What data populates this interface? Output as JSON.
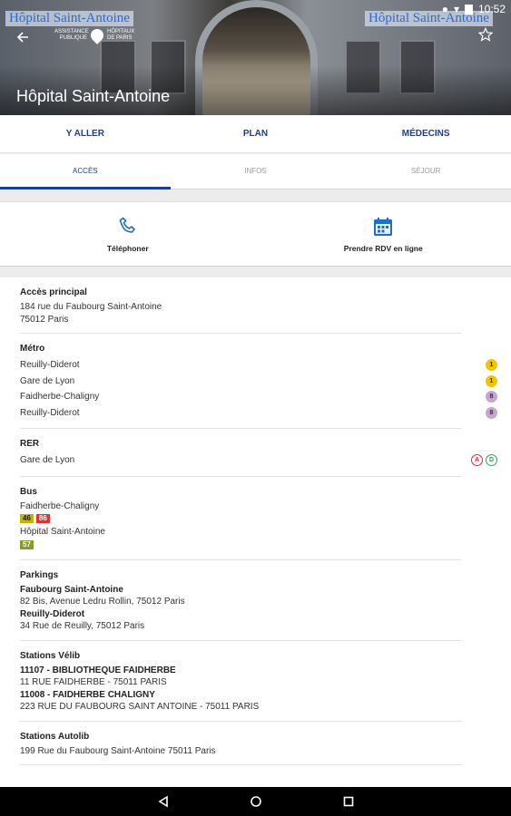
{
  "status_bar": {
    "time": "10:52"
  },
  "hero": {
    "title": "Hôpital Saint-Antoine",
    "sign_left": "Hôpital Saint-Antoine",
    "sign_right": "Hôpital Saint-Antoine",
    "logo_text_left": "ASSISTANCE PUBLIQUE",
    "logo_text_right": "HÔPITAUX DE PARIS"
  },
  "tabs": [
    {
      "label": "Y ALLER"
    },
    {
      "label": "PLAN"
    },
    {
      "label": "MÉDECINS"
    }
  ],
  "subtabs": [
    {
      "label": "ACCÈS",
      "active": true
    },
    {
      "label": "INFOS"
    },
    {
      "label": "SÉJOUR"
    }
  ],
  "actions": [
    {
      "label": "Téléphoner",
      "icon": "phone-icon"
    },
    {
      "label": "Prendre RDV en ligne",
      "icon": "calendar-icon"
    }
  ],
  "access": {
    "main": {
      "title": "Accès principal",
      "lines": [
        "184 rue du Faubourg Saint-Antoine",
        "75012 Paris"
      ]
    },
    "metro": {
      "title": "Métro",
      "stations": [
        {
          "name": "Reuilly-Diderot",
          "line": "1"
        },
        {
          "name": "Gare de Lyon",
          "line": "1"
        },
        {
          "name": "Faidherbe-Chaligny",
          "line": "8"
        },
        {
          "name": "Reuilly-Diderot",
          "line": "8"
        }
      ]
    },
    "rer": {
      "title": "RER",
      "station": "Gare de Lyon",
      "lines": [
        "A",
        "D"
      ]
    },
    "bus": {
      "title": "Bus",
      "stops": [
        {
          "name": "Faidherbe-Chaligny",
          "lines": [
            "46",
            "86"
          ]
        },
        {
          "name": "Hôpital Saint-Antoine",
          "lines": [
            "57"
          ]
        }
      ]
    },
    "parkings": {
      "title": "Parkings",
      "items": [
        {
          "name": "Faubourg Saint-Antoine",
          "address": "82 Bis, Avenue Ledru Rollin, 75012 Paris"
        },
        {
          "name": "Reuilly-Diderot",
          "address": "34 Rue de Reuilly, 75012 Paris"
        }
      ]
    },
    "velib": {
      "title": "Stations Vélib",
      "items": [
        {
          "name": "11107 - BIBLIOTHEQUE FAIDHERBE",
          "address": "11 RUE FAIDHERBE - 75011 PARIS"
        },
        {
          "name": "11008 - FAIDHERBE CHALIGNY",
          "address": "223 RUE DU FAUBOURG SAINT ANTOINE - 75011 PARIS"
        }
      ]
    },
    "autolib": {
      "title": "Stations Autolib",
      "address": "199 Rue du Faubourg Saint-Antoine 75011 Paris"
    }
  },
  "colors": {
    "primary": "#1a3f8f",
    "metro_1": "#f2c400",
    "metro_8": "#c6a6cf",
    "rer_a": "#e3263b",
    "rer_d": "#2fa84f"
  }
}
